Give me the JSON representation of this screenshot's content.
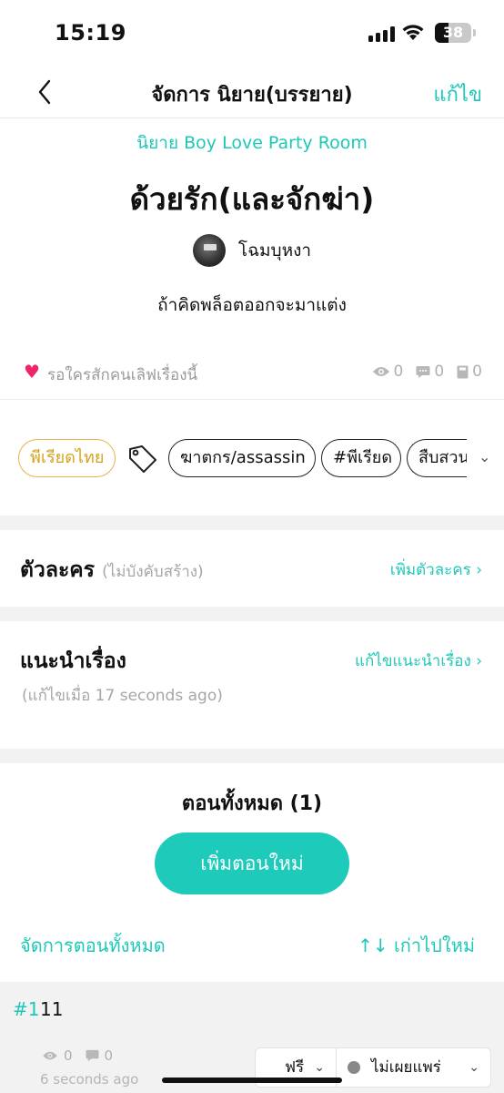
{
  "status_bar": {
    "time": "15:19",
    "battery": "38",
    "battery_level": 0.38
  },
  "nav": {
    "title": "จัดการ นิยาย(บรรยาย)",
    "edit_label": "แก้ไข"
  },
  "story": {
    "category": "นิยาย Boy Love Party Room",
    "title": "ด้วยรัก(และจักฆ่า)",
    "author": "โฉมบุหงา",
    "tagline": "ถ้าคิดพล็อตออกจะมาแต่ง"
  },
  "love": {
    "text": "รอใครสักคนเลิฟเรื่องนี้"
  },
  "stats": {
    "views": "0",
    "comments": "0",
    "saves": "0"
  },
  "tags": {
    "genre": "พีเรียดไทย",
    "items": [
      "ฆาตกร/assassin",
      "#พีเรียด",
      "สืบสวน"
    ]
  },
  "characters": {
    "title": "ตัวละคร",
    "note": "(ไม่บังคับสร้าง)",
    "link": "เพิ่มตัวละคร"
  },
  "intro": {
    "title": "แนะนำเรื่อง",
    "updated": "(แก้ไขเมื่อ 17 seconds ago)",
    "link": "แก้ไขแนะนำเรื่อง"
  },
  "episodes": {
    "title": "ตอนทั้งหมด (1)",
    "add_label": "เพิ่มตอนใหม่",
    "manage_label": "จัดการตอนทั้งหมด",
    "sort_label": "เก่าไปใหม่",
    "list": [
      {
        "num": "#1",
        "name": "11",
        "views": "0",
        "comments": "0",
        "time": "6 seconds ago",
        "price": "ฟรี",
        "status": "ไม่เผยแพร่"
      }
    ]
  },
  "colors": {
    "accent": "#1ec8b8",
    "heart": "#f0246b",
    "genre": "#d4a21e"
  }
}
